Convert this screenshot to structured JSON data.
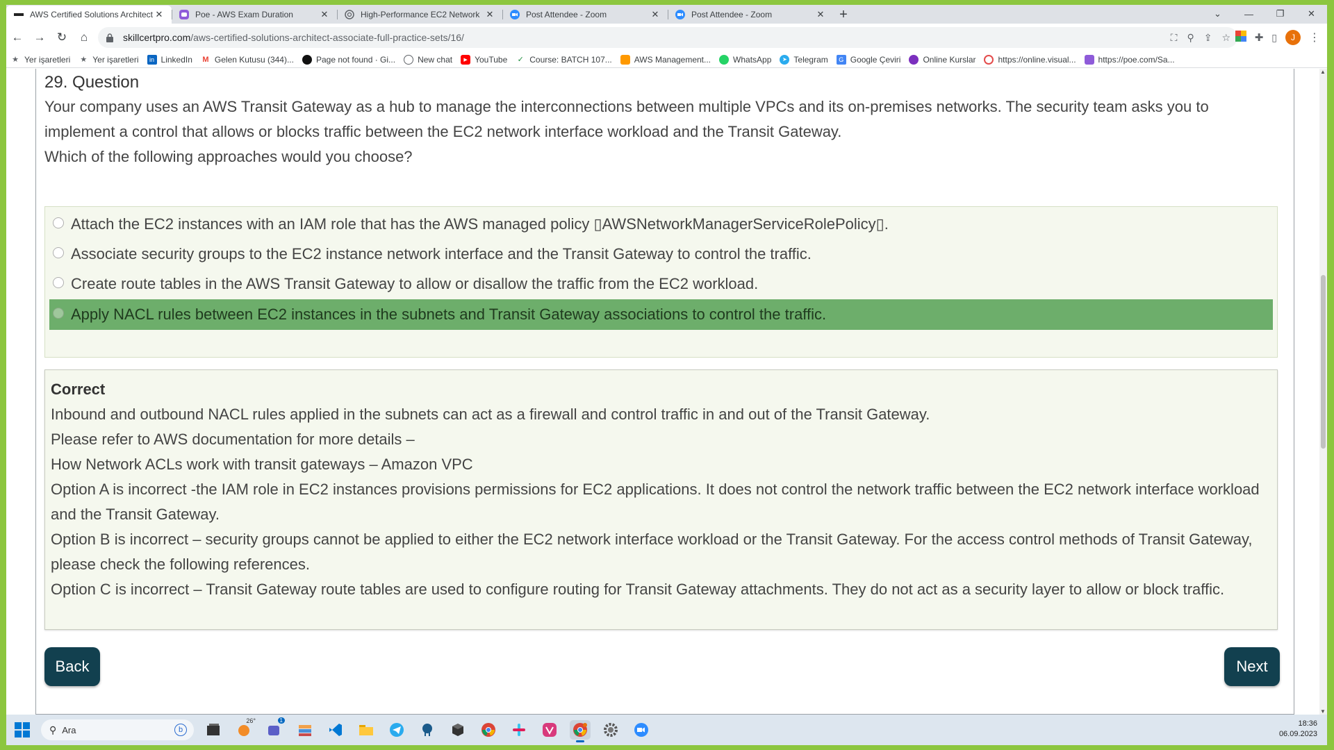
{
  "browser": {
    "tabs": [
      {
        "title": "AWS Certified Solutions Architect",
        "active": true,
        "icon": "skillcert-favicon"
      },
      {
        "title": "Poe - AWS Exam Duration",
        "active": false,
        "icon": "poe-favicon"
      },
      {
        "title": "High-Performance EC2 Network",
        "active": false,
        "icon": "openai-favicon"
      },
      {
        "title": "Post Attendee - Zoom",
        "active": false,
        "icon": "zoom-favicon"
      },
      {
        "title": "Post Attendee - Zoom",
        "active": false,
        "icon": "zoom-favicon"
      }
    ],
    "close_glyph": "✕",
    "new_tab_glyph": "+",
    "url_host": "skillcertpro.com",
    "url_path": "/aws-certified-solutions-architect-associate-full-practice-sets/16/",
    "profile_initial": "J"
  },
  "bookmarks": [
    {
      "label": "Yer işaretleri",
      "icon": "star-icon"
    },
    {
      "label": "Yer işaretleri",
      "icon": "star-icon"
    },
    {
      "label": "LinkedIn",
      "icon": "linkedin-icon"
    },
    {
      "label": "Gelen Kutusu (344)...",
      "icon": "gmail-icon"
    },
    {
      "label": "Page not found · Gi...",
      "icon": "github-icon"
    },
    {
      "label": "New chat",
      "icon": "openai-icon"
    },
    {
      "label": "YouTube",
      "icon": "youtube-icon"
    },
    {
      "label": "Course: BATCH 107...",
      "icon": "course-icon"
    },
    {
      "label": "AWS Management...",
      "icon": "aws-icon"
    },
    {
      "label": "WhatsApp",
      "icon": "whatsapp-icon"
    },
    {
      "label": "Telegram",
      "icon": "telegram-icon"
    },
    {
      "label": "Google Çeviri",
      "icon": "translate-icon"
    },
    {
      "label": "Online Kurslar",
      "icon": "courses-icon"
    },
    {
      "label": "https://online.visual...",
      "icon": "web-icon"
    },
    {
      "label": "https://poe.com/Sa...",
      "icon": "poe-icon"
    }
  ],
  "question": {
    "heading": "29. Question",
    "text": "Your company uses an AWS Transit Gateway as a hub to manage the interconnections between multiple VPCs and its on-premises networks. The security team asks you to implement a control that allows or blocks traffic between the EC2 network interface workload and the Transit Gateway.",
    "prompt": "Which of the following approaches would you choose?"
  },
  "options": [
    {
      "text": "Attach the EC2 instances with an IAM role that has the AWS managed policy ▯AWSNetworkManagerServiceRolePolicy▯.",
      "selected": false
    },
    {
      "text": "Associate security groups to the EC2 instance network interface and the Transit Gateway to control the traffic.",
      "selected": false
    },
    {
      "text": "Create route tables in the AWS Transit Gateway to allow or disallow the traffic from the EC2 workload.",
      "selected": false
    },
    {
      "text": "Apply NACL rules between EC2 instances in the subnets and Transit Gateway associations to control the traffic.",
      "selected": true
    }
  ],
  "explanation": {
    "status": "Correct",
    "lines": [
      "Inbound and outbound NACL rules applied in the subnets can act as a firewall and control traffic in and out of the Transit Gateway.",
      "Please refer to AWS documentation for more details –",
      "How Network ACLs work with transit gateways – Amazon VPC",
      "Option A is incorrect -the IAM role in EC2 instances provisions permissions for EC2 applications. It does not control the network traffic between the EC2 network interface workload and the Transit Gateway.",
      "Option B is incorrect – security groups cannot be applied to either the EC2 network interface workload or the Transit Gateway. For the access control methods of Transit Gateway, please check the following references.",
      "Option C is incorrect – Transit Gateway route tables are used to configure routing for Transit Gateway attachments. They do not act as a security layer to allow or block traffic."
    ]
  },
  "buttons": {
    "back": "Back",
    "next": "Next"
  },
  "taskbar": {
    "search_placeholder": "Ara",
    "weather": "26°",
    "teams_badge": "1",
    "time": "18:36",
    "date": "06.09.2023"
  },
  "colors": {
    "selected_option": "#6dae6b",
    "button": "#12404f",
    "border_frame": "#8cc63f"
  }
}
